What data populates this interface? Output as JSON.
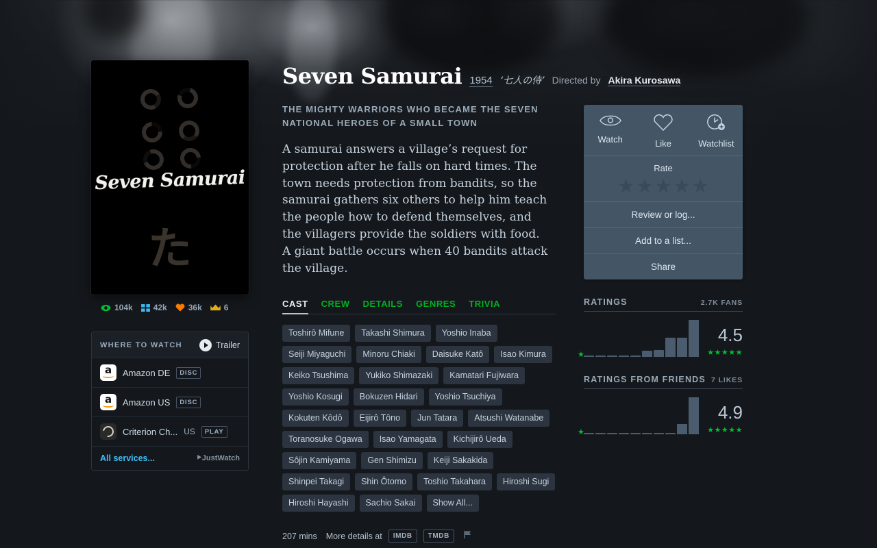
{
  "film": {
    "title": "Seven Samurai",
    "year": "1954",
    "original_title": "‘七人の侍’",
    "directed_by_label": "Directed by",
    "director": "Akira Kurosawa",
    "tagline": "THE MIGHTY WARRIORS WHO BECAME THE SEVEN NATIONAL HEROES OF A SMALL TOWN",
    "synopsis": "A samurai answers a village’s request for protection after he falls on hard times. The town needs protection from bandits, so the samurai gathers six others to help him teach the people how to defend themselves, and the villagers provide the soldiers with food. A giant battle occurs when 40 bandits attack the village.",
    "runtime": "207 mins",
    "more_details_label": "More details at",
    "external_links": [
      "IMDB",
      "TMDB"
    ],
    "report_icon": "flag-icon"
  },
  "poster": {
    "title_script": "Seven Samurai",
    "kanji": "た",
    "ring_count": 6,
    "background_color": "#000000"
  },
  "stats": [
    {
      "icon": "eye-icon",
      "value": "104k",
      "color": "#00c030"
    },
    {
      "icon": "lists-icon",
      "value": "42k",
      "color": "#40bcf4"
    },
    {
      "icon": "heart-icon",
      "value": "36k",
      "color": "#ff8000"
    },
    {
      "icon": "crown-icon",
      "value": "6",
      "color": "#e0b020"
    }
  ],
  "where_to_watch": {
    "heading": "WHERE TO WATCH",
    "trailer_label": "Trailer",
    "services": [
      {
        "name": "Amazon DE",
        "logo": "amazon-icon",
        "region": "",
        "badge": "DISC"
      },
      {
        "name": "Amazon US",
        "logo": "amazon-icon",
        "region": "",
        "badge": "DISC"
      },
      {
        "name": "Criterion Ch...",
        "logo": "criterion-icon",
        "region": "US",
        "badge": "PLAY"
      }
    ],
    "all_services_label": "All services...",
    "provider_label": "JustWatch"
  },
  "tabs": [
    {
      "label": "CAST",
      "active": true
    },
    {
      "label": "CREW",
      "active": false
    },
    {
      "label": "DETAILS",
      "active": false
    },
    {
      "label": "GENRES",
      "active": false
    },
    {
      "label": "TRIVIA",
      "active": false
    }
  ],
  "cast": [
    "Toshirô Mifune",
    "Takashi Shimura",
    "Yoshio Inaba",
    "Seiji Miyaguchi",
    "Minoru Chiaki",
    "Daisuke Katô",
    "Isao Kimura",
    "Keiko Tsushima",
    "Yukiko Shimazaki",
    "Kamatari Fujiwara",
    "Yoshio Kosugi",
    "Bokuzen Hidari",
    "Yoshio Tsuchiya",
    "Kokuten Kôdô",
    "Eijirô Tôno",
    "Jun Tatara",
    "Atsushi Watanabe",
    "Toranosuke Ogawa",
    "Isao Yamagata",
    "Kichijirô Ueda",
    "Sôjin Kamiyama",
    "Gen Shimizu",
    "Keiji Sakakida",
    "Shinpei Takagi",
    "Shin Ôtomo",
    "Toshio Takahara",
    "Hiroshi Sugi",
    "Hiroshi Hayashi",
    "Sachio Sakai",
    "Show All..."
  ],
  "action_panel": {
    "actions": [
      {
        "icon": "eye-outline-icon",
        "label": "Watch"
      },
      {
        "icon": "heart-outline-icon",
        "label": "Like"
      },
      {
        "icon": "watchlist-clock-icon",
        "label": "Watchlist"
      }
    ],
    "rate_label": "Rate",
    "star_count": 5,
    "buttons": [
      "Review or log...",
      "Add to a list...",
      "Share"
    ]
  },
  "chart_data": [
    {
      "type": "bar",
      "title": "RATINGS",
      "subtitle": "2.7K FANS",
      "categories": [
        "0.5",
        "1",
        "1.5",
        "2",
        "2.5",
        "3",
        "3.5",
        "4",
        "4.5",
        "5"
      ],
      "values": [
        1,
        1,
        1,
        1,
        1,
        8,
        9,
        26,
        26,
        50
      ],
      "ylim": [
        0,
        52
      ],
      "average": "4.5",
      "average_stars": "★★★★★",
      "xlabel": "",
      "ylabel": "",
      "grid": false,
      "legend": "none"
    },
    {
      "type": "bar",
      "title": "RATINGS FROM FRIENDS",
      "subtitle": "7 LIKES",
      "categories": [
        "0.5",
        "1",
        "1.5",
        "2",
        "2.5",
        "3",
        "3.5",
        "4",
        "4.5",
        "5"
      ],
      "values": [
        0,
        0,
        0,
        0,
        0,
        0,
        0,
        0,
        14,
        50
      ],
      "ylim": [
        0,
        52
      ],
      "average": "4.9",
      "average_stars": "★★★★★",
      "xlabel": "",
      "ylabel": "",
      "grid": false,
      "legend": "none"
    }
  ],
  "colors": {
    "page_bg": "#14181c",
    "panel_bg": "#445566",
    "chip_bg": "#2c3440",
    "green": "#00c030",
    "blue": "#40bcf4",
    "bar": "#4a5c6e"
  }
}
